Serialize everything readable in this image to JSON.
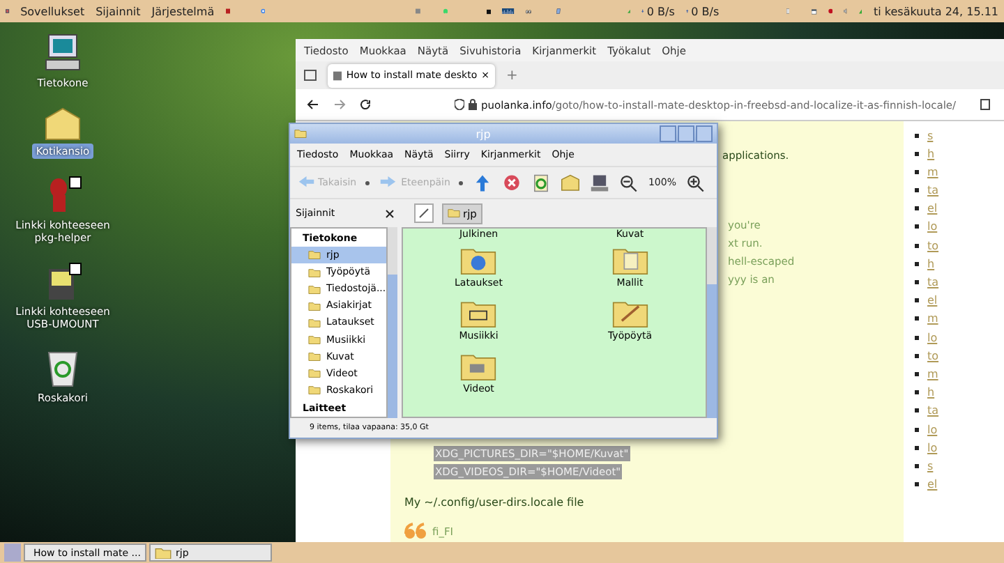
{
  "top_panel": {
    "menus": [
      "Sovellukset",
      "Sijainnit",
      "Järjestelmä"
    ],
    "download_rate": "0 B/s",
    "upload_rate": "0 B/s",
    "clock": "ti kesäkuuta 24, 15.11"
  },
  "desktop_icons": [
    {
      "kind": "computer",
      "label": "Tietokone",
      "selected": false
    },
    {
      "kind": "home",
      "label": "Kotikansio",
      "selected": true
    },
    {
      "kind": "daemon",
      "label": "Linkki kohteeseen pkg-helper",
      "selected": false
    },
    {
      "kind": "drive",
      "label": "Linkki kohteeseen USB-UMOUNT",
      "selected": false
    },
    {
      "kind": "trash",
      "label": "Roskakori",
      "selected": false
    }
  ],
  "browser": {
    "menu": [
      "Tiedosto",
      "Muokkaa",
      "Näytä",
      "Sivuhistoria",
      "Kirjanmerkit",
      "Työkalut",
      "Ohje"
    ],
    "tab": {
      "title": "How to install mate deskto",
      "close": "×"
    },
    "new_tab": "+",
    "url_host": "puolanka.info",
    "url_path": "/goto/how-to-install-mate-desktop-in-freebsd-and-localize-it-as-finnish-locale/",
    "article": {
      "first_fragment": "applications.",
      "fragments": [
        "you're",
        "xt run.",
        "hell-escaped",
        "yyy is an"
      ],
      "code_lines": [
        "XDG_PICTURES_DIR=\"$HOME/Kuvat\"",
        "XDG_VIDEOS_DIR=\"$HOME/Videot\""
      ],
      "paragraph": "My ~/.config/user-dirs.locale file",
      "quote": "fi_FI"
    },
    "sidebar_links": [
      "s",
      "h",
      "m",
      "ta",
      "el",
      "lo",
      "to",
      "h",
      "ta",
      "el",
      "m",
      "lo",
      "to",
      "m",
      "h",
      "ta",
      "lo",
      "lo",
      "s",
      "el"
    ]
  },
  "file_manager": {
    "title": "rjp",
    "menu": [
      "Tiedosto",
      "Muokkaa",
      "Näytä",
      "Siirry",
      "Kirjanmerkit",
      "Ohje"
    ],
    "toolbar": [
      {
        "kind": "back",
        "label": "Takaisin",
        "disabled": true
      },
      {
        "kind": "forward",
        "label": "Eteenpäin",
        "disabled": true
      },
      {
        "kind": "up"
      },
      {
        "kind": "stop"
      },
      {
        "kind": "reload"
      },
      {
        "kind": "home"
      },
      {
        "kind": "computer"
      },
      {
        "kind": "zoom_out"
      },
      {
        "kind": "zoom_level",
        "label": "100%"
      },
      {
        "kind": "zoom_in"
      }
    ],
    "places_label": "Sijainnit",
    "path_button": "rjp",
    "sidebar": {
      "heading": "Tietokone",
      "items": [
        {
          "label": "rjp",
          "selected": true
        },
        {
          "label": "Työpöytä",
          "selected": false
        },
        {
          "label": "Tiedostojä...",
          "selected": false
        },
        {
          "label": "Asiakirjat",
          "selected": false
        },
        {
          "label": "Lataukset",
          "selected": false
        },
        {
          "label": "Musiikki",
          "selected": false
        },
        {
          "label": "Kuvat",
          "selected": false
        },
        {
          "label": "Videot",
          "selected": false
        },
        {
          "label": "Roskakori",
          "selected": false
        }
      ],
      "next_heading": "Laitteet"
    },
    "cut_labels": [
      "Julkinen",
      "Kuvat"
    ],
    "items": [
      {
        "label": "Lataukset",
        "kind": "web"
      },
      {
        "label": "Mallit",
        "kind": "templates"
      },
      {
        "label": "Musiikki",
        "kind": "music"
      },
      {
        "label": "Työpöytä",
        "kind": "desktop"
      },
      {
        "label": "Videot",
        "kind": "video"
      }
    ],
    "status": "9 items, tilaa vapaana: 35,0 Gt"
  },
  "taskbar": {
    "buttons": [
      {
        "label": "How to install mate ...",
        "kind": "browser",
        "selected": false
      },
      {
        "label": "rjp",
        "kind": "folder",
        "selected": false
      }
    ]
  }
}
